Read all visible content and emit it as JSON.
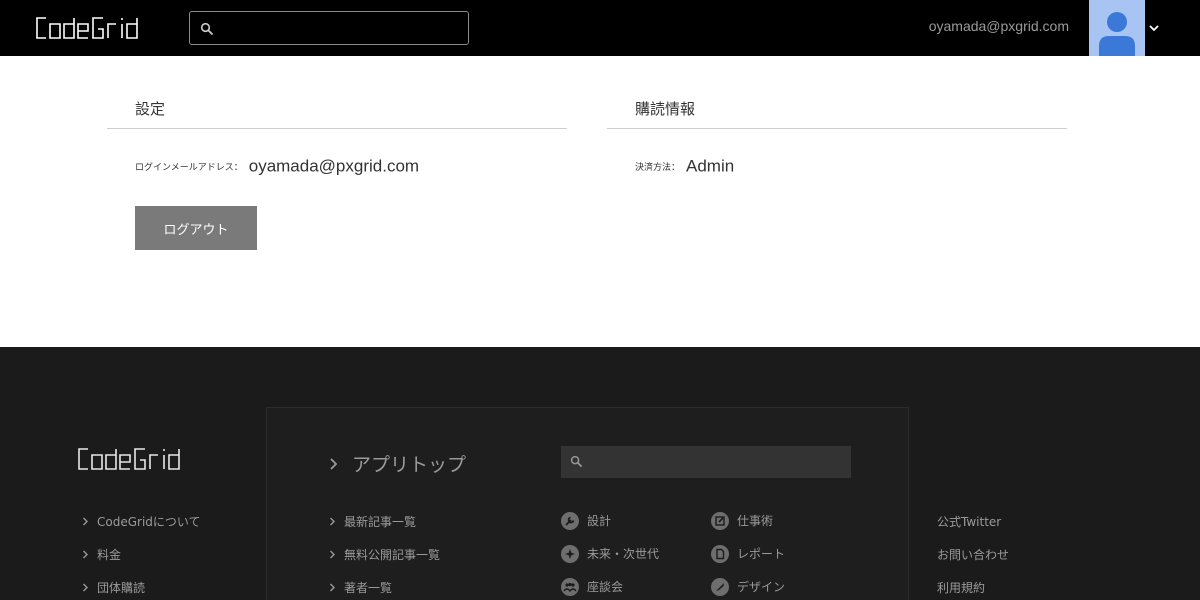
{
  "header": {
    "logo_text": "CodeGrid",
    "search": {
      "value": "",
      "placeholder": ""
    },
    "user_email": "oyamada@pxgrid.com",
    "avatar_icon": "user-avatar-icon",
    "menu_icon": "chevron-down-icon"
  },
  "settings": {
    "title": "設定",
    "email_label": "ログインメールアドレス：",
    "email_value": "oyamada@pxgrid.com",
    "logout_label": "ログアウト"
  },
  "subscription": {
    "title": "購読情報",
    "payment_label": "決済方法：",
    "payment_value": "Admin"
  },
  "footer": {
    "logo_text": "CodeGrid",
    "left_links": [
      "CodeGridについて",
      "料金",
      "団体購読"
    ],
    "app_top": "アプリトップ",
    "search": {
      "value": "",
      "placeholder": ""
    },
    "article_links": [
      "最新記事一覧",
      "無料公開記事一覧",
      "著者一覧"
    ],
    "categories_col1": [
      {
        "label": "設計",
        "icon": "wrench-icon"
      },
      {
        "label": "未来・次世代",
        "icon": "sparkle-icon"
      },
      {
        "label": "座談会",
        "icon": "people-icon"
      }
    ],
    "categories_col2": [
      {
        "label": "仕事術",
        "icon": "edit-icon"
      },
      {
        "label": "レポート",
        "icon": "document-icon"
      },
      {
        "label": "デザイン",
        "icon": "brush-icon"
      }
    ],
    "right_links": [
      "公式Twitter",
      "お問い合わせ",
      "利用規約"
    ]
  },
  "colors": {
    "header_bg": "#000000",
    "footer_bg": "#1b1b1b",
    "avatar_bg": "#a7c4f2",
    "avatar_fg": "#3c78d8",
    "button_bg": "#7a7a7a"
  }
}
